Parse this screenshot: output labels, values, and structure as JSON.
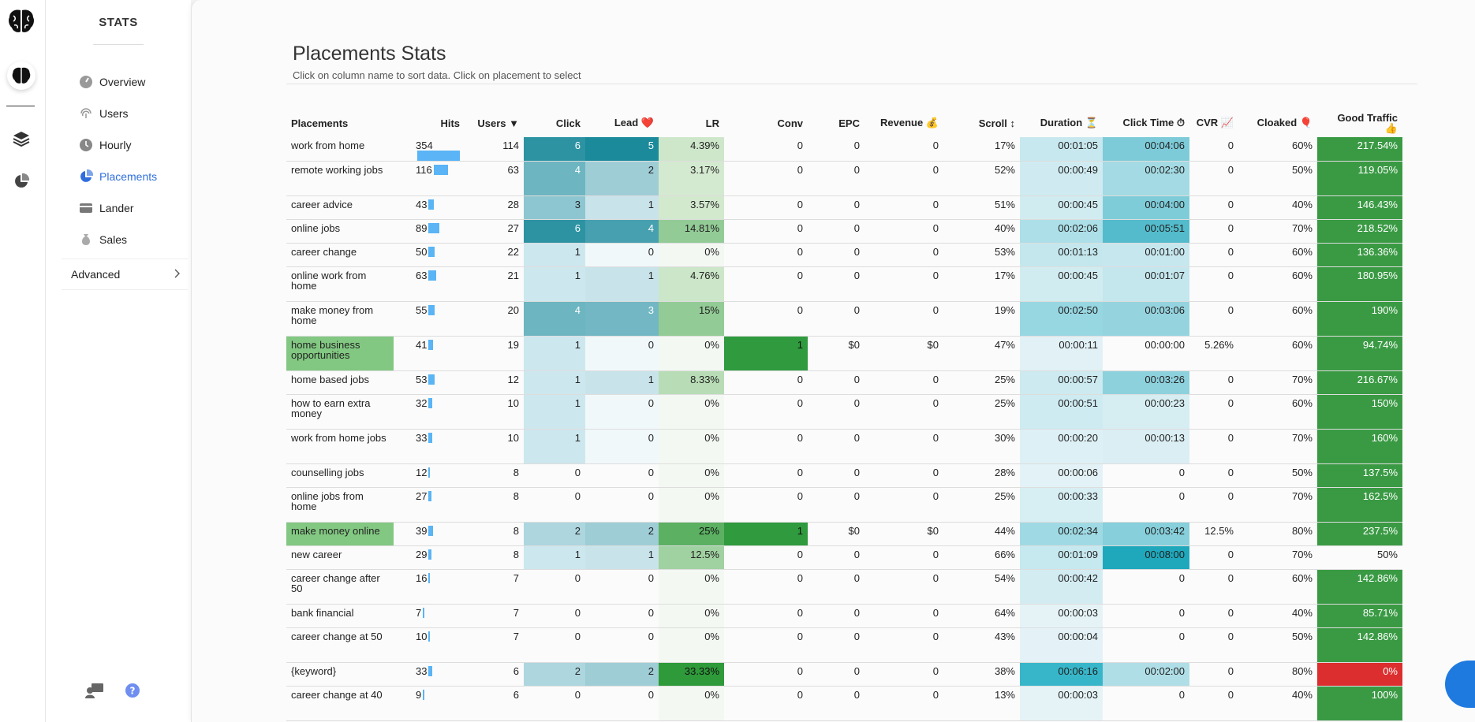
{
  "sidebar": {
    "title": "STATS",
    "items": [
      {
        "label": "Overview",
        "icon": "gauge-icon"
      },
      {
        "label": "Users",
        "icon": "fingerprint-icon"
      },
      {
        "label": "Hourly",
        "icon": "clock-icon"
      },
      {
        "label": "Placements",
        "icon": "pie-chart-icon"
      },
      {
        "label": "Lander",
        "icon": "card-icon"
      },
      {
        "label": "Sales",
        "icon": "money-bag-icon"
      }
    ],
    "advanced_label": "Advanced"
  },
  "page": {
    "title": "Placements Stats",
    "subtitle": "Click on column name to sort data. Click on placement to select"
  },
  "table": {
    "headers": [
      "Placements",
      "Hits",
      "Users ▼",
      "Click",
      "Lead ❤️",
      "LR",
      "Conv",
      "EPC",
      "Revenue 💰",
      "Scroll ↕",
      "Duration ⏳",
      "Click Time ⏱",
      "CVR 📈",
      "Cloaked 🎈",
      "Good Traffic 👍"
    ],
    "max_hits": 354,
    "rows": [
      [
        "work from home",
        354,
        "114",
        "6",
        "5",
        "4.39%",
        "0",
        "0",
        "0",
        "17%",
        "00:01:05",
        "00:04:06",
        "0",
        "60%",
        "217.54%"
      ],
      [
        "remote working jobs",
        116,
        "63",
        "4",
        "2",
        "3.17%",
        "0",
        "0",
        "0",
        "52%",
        "00:00:49",
        "00:02:30",
        "0",
        "50%",
        "119.05%"
      ],
      [
        "career advice",
        43,
        "28",
        "3",
        "1",
        "3.57%",
        "0",
        "0",
        "0",
        "51%",
        "00:00:45",
        "00:04:00",
        "0",
        "40%",
        "146.43%"
      ],
      [
        "online jobs",
        89,
        "27",
        "6",
        "4",
        "14.81%",
        "0",
        "0",
        "0",
        "40%",
        "00:02:06",
        "00:05:51",
        "0",
        "70%",
        "218.52%"
      ],
      [
        "career change",
        50,
        "22",
        "1",
        "0",
        "0%",
        "0",
        "0",
        "0",
        "53%",
        "00:01:13",
        "00:01:00",
        "0",
        "60%",
        "136.36%"
      ],
      [
        "online work from home",
        63,
        "21",
        "1",
        "1",
        "4.76%",
        "0",
        "0",
        "0",
        "17%",
        "00:00:45",
        "00:01:07",
        "0",
        "60%",
        "180.95%"
      ],
      [
        "make money from home",
        55,
        "20",
        "4",
        "3",
        "15%",
        "0",
        "0",
        "0",
        "19%",
        "00:02:50",
        "00:03:06",
        "0",
        "60%",
        "190%"
      ],
      [
        "home business opportunities",
        41,
        "19",
        "1",
        "0",
        "0%",
        "1",
        "$0",
        "$0",
        "47%",
        "00:00:11",
        "00:00:00",
        "5.26%",
        "60%",
        "94.74%"
      ],
      [
        "home based jobs",
        53,
        "12",
        "1",
        "1",
        "8.33%",
        "0",
        "0",
        "0",
        "25%",
        "00:00:57",
        "00:03:26",
        "0",
        "70%",
        "216.67%"
      ],
      [
        "how to earn extra money",
        32,
        "10",
        "1",
        "0",
        "0%",
        "0",
        "0",
        "0",
        "25%",
        "00:00:51",
        "00:00:23",
        "0",
        "60%",
        "150%"
      ],
      [
        "work from home jobs",
        33,
        "10",
        "1",
        "0",
        "0%",
        "0",
        "0",
        "0",
        "30%",
        "00:00:20",
        "00:00:13",
        "0",
        "70%",
        "160%"
      ],
      [
        "counselling jobs",
        12,
        "8",
        "0",
        "0",
        "0%",
        "0",
        "0",
        "0",
        "28%",
        "00:00:06",
        "0",
        "0",
        "50%",
        "137.5%"
      ],
      [
        "online jobs from home",
        27,
        "8",
        "0",
        "0",
        "0%",
        "0",
        "0",
        "0",
        "25%",
        "00:00:33",
        "0",
        "0",
        "70%",
        "162.5%"
      ],
      [
        "make money online",
        39,
        "8",
        "2",
        "2",
        "25%",
        "1",
        "$0",
        "$0",
        "44%",
        "00:02:34",
        "00:03:42",
        "12.5%",
        "80%",
        "237.5%"
      ],
      [
        "new career",
        29,
        "8",
        "1",
        "1",
        "12.5%",
        "0",
        "0",
        "0",
        "66%",
        "00:01:09",
        "00:08:00",
        "0",
        "70%",
        "50%"
      ],
      [
        "career change after 50",
        16,
        "7",
        "0",
        "0",
        "0%",
        "0",
        "0",
        "0",
        "54%",
        "00:00:42",
        "0",
        "0",
        "60%",
        "142.86%"
      ],
      [
        "bank financial",
        7,
        "7",
        "0",
        "0",
        "0%",
        "0",
        "0",
        "0",
        "64%",
        "00:00:03",
        "0",
        "0",
        "40%",
        "85.71%"
      ],
      [
        "career change at 50",
        10,
        "7",
        "0",
        "0",
        "0%",
        "0",
        "0",
        "0",
        "43%",
        "00:00:04",
        "0",
        "0",
        "50%",
        "142.86%"
      ],
      [
        "{keyword}",
        33,
        "6",
        "2",
        "2",
        "33.33%",
        "0",
        "0",
        "0",
        "38%",
        "00:06:16",
        "00:02:00",
        "0",
        "80%",
        "0%"
      ],
      [
        "career change at 40",
        9,
        "6",
        "0",
        "0",
        "0%",
        "0",
        "0",
        "0",
        "13%",
        "00:00:03",
        "0",
        "0",
        "40%",
        "100%"
      ]
    ]
  },
  "colors": {
    "accent": "#2f6fdc",
    "hits_bar": "#5ab4f5",
    "good": "#3a9a44",
    "bad": "#dc2e2e",
    "conv_green": "#2f9a3e",
    "highlight_row": "#82c882"
  }
}
